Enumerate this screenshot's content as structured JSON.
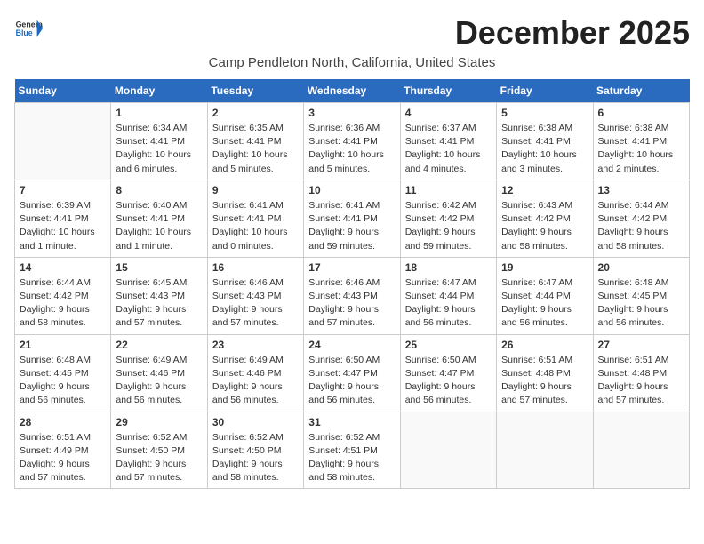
{
  "header": {
    "logo_line1": "General",
    "logo_line2": "Blue",
    "month_title": "December 2025",
    "location": "Camp Pendleton North, California, United States"
  },
  "weekdays": [
    "Sunday",
    "Monday",
    "Tuesday",
    "Wednesday",
    "Thursday",
    "Friday",
    "Saturday"
  ],
  "weeks": [
    [
      {
        "day": "",
        "info": ""
      },
      {
        "day": "1",
        "info": "Sunrise: 6:34 AM\nSunset: 4:41 PM\nDaylight: 10 hours\nand 6 minutes."
      },
      {
        "day": "2",
        "info": "Sunrise: 6:35 AM\nSunset: 4:41 PM\nDaylight: 10 hours\nand 5 minutes."
      },
      {
        "day": "3",
        "info": "Sunrise: 6:36 AM\nSunset: 4:41 PM\nDaylight: 10 hours\nand 5 minutes."
      },
      {
        "day": "4",
        "info": "Sunrise: 6:37 AM\nSunset: 4:41 PM\nDaylight: 10 hours\nand 4 minutes."
      },
      {
        "day": "5",
        "info": "Sunrise: 6:38 AM\nSunset: 4:41 PM\nDaylight: 10 hours\nand 3 minutes."
      },
      {
        "day": "6",
        "info": "Sunrise: 6:38 AM\nSunset: 4:41 PM\nDaylight: 10 hours\nand 2 minutes."
      }
    ],
    [
      {
        "day": "7",
        "info": "Sunrise: 6:39 AM\nSunset: 4:41 PM\nDaylight: 10 hours\nand 1 minute."
      },
      {
        "day": "8",
        "info": "Sunrise: 6:40 AM\nSunset: 4:41 PM\nDaylight: 10 hours\nand 1 minute."
      },
      {
        "day": "9",
        "info": "Sunrise: 6:41 AM\nSunset: 4:41 PM\nDaylight: 10 hours\nand 0 minutes."
      },
      {
        "day": "10",
        "info": "Sunrise: 6:41 AM\nSunset: 4:41 PM\nDaylight: 9 hours\nand 59 minutes."
      },
      {
        "day": "11",
        "info": "Sunrise: 6:42 AM\nSunset: 4:42 PM\nDaylight: 9 hours\nand 59 minutes."
      },
      {
        "day": "12",
        "info": "Sunrise: 6:43 AM\nSunset: 4:42 PM\nDaylight: 9 hours\nand 58 minutes."
      },
      {
        "day": "13",
        "info": "Sunrise: 6:44 AM\nSunset: 4:42 PM\nDaylight: 9 hours\nand 58 minutes."
      }
    ],
    [
      {
        "day": "14",
        "info": "Sunrise: 6:44 AM\nSunset: 4:42 PM\nDaylight: 9 hours\nand 58 minutes."
      },
      {
        "day": "15",
        "info": "Sunrise: 6:45 AM\nSunset: 4:43 PM\nDaylight: 9 hours\nand 57 minutes."
      },
      {
        "day": "16",
        "info": "Sunrise: 6:46 AM\nSunset: 4:43 PM\nDaylight: 9 hours\nand 57 minutes."
      },
      {
        "day": "17",
        "info": "Sunrise: 6:46 AM\nSunset: 4:43 PM\nDaylight: 9 hours\nand 57 minutes."
      },
      {
        "day": "18",
        "info": "Sunrise: 6:47 AM\nSunset: 4:44 PM\nDaylight: 9 hours\nand 56 minutes."
      },
      {
        "day": "19",
        "info": "Sunrise: 6:47 AM\nSunset: 4:44 PM\nDaylight: 9 hours\nand 56 minutes."
      },
      {
        "day": "20",
        "info": "Sunrise: 6:48 AM\nSunset: 4:45 PM\nDaylight: 9 hours\nand 56 minutes."
      }
    ],
    [
      {
        "day": "21",
        "info": "Sunrise: 6:48 AM\nSunset: 4:45 PM\nDaylight: 9 hours\nand 56 minutes."
      },
      {
        "day": "22",
        "info": "Sunrise: 6:49 AM\nSunset: 4:46 PM\nDaylight: 9 hours\nand 56 minutes."
      },
      {
        "day": "23",
        "info": "Sunrise: 6:49 AM\nSunset: 4:46 PM\nDaylight: 9 hours\nand 56 minutes."
      },
      {
        "day": "24",
        "info": "Sunrise: 6:50 AM\nSunset: 4:47 PM\nDaylight: 9 hours\nand 56 minutes."
      },
      {
        "day": "25",
        "info": "Sunrise: 6:50 AM\nSunset: 4:47 PM\nDaylight: 9 hours\nand 56 minutes."
      },
      {
        "day": "26",
        "info": "Sunrise: 6:51 AM\nSunset: 4:48 PM\nDaylight: 9 hours\nand 57 minutes."
      },
      {
        "day": "27",
        "info": "Sunrise: 6:51 AM\nSunset: 4:48 PM\nDaylight: 9 hours\nand 57 minutes."
      }
    ],
    [
      {
        "day": "28",
        "info": "Sunrise: 6:51 AM\nSunset: 4:49 PM\nDaylight: 9 hours\nand 57 minutes."
      },
      {
        "day": "29",
        "info": "Sunrise: 6:52 AM\nSunset: 4:50 PM\nDaylight: 9 hours\nand 57 minutes."
      },
      {
        "day": "30",
        "info": "Sunrise: 6:52 AM\nSunset: 4:50 PM\nDaylight: 9 hours\nand 58 minutes."
      },
      {
        "day": "31",
        "info": "Sunrise: 6:52 AM\nSunset: 4:51 PM\nDaylight: 9 hours\nand 58 minutes."
      },
      {
        "day": "",
        "info": ""
      },
      {
        "day": "",
        "info": ""
      },
      {
        "day": "",
        "info": ""
      }
    ]
  ]
}
